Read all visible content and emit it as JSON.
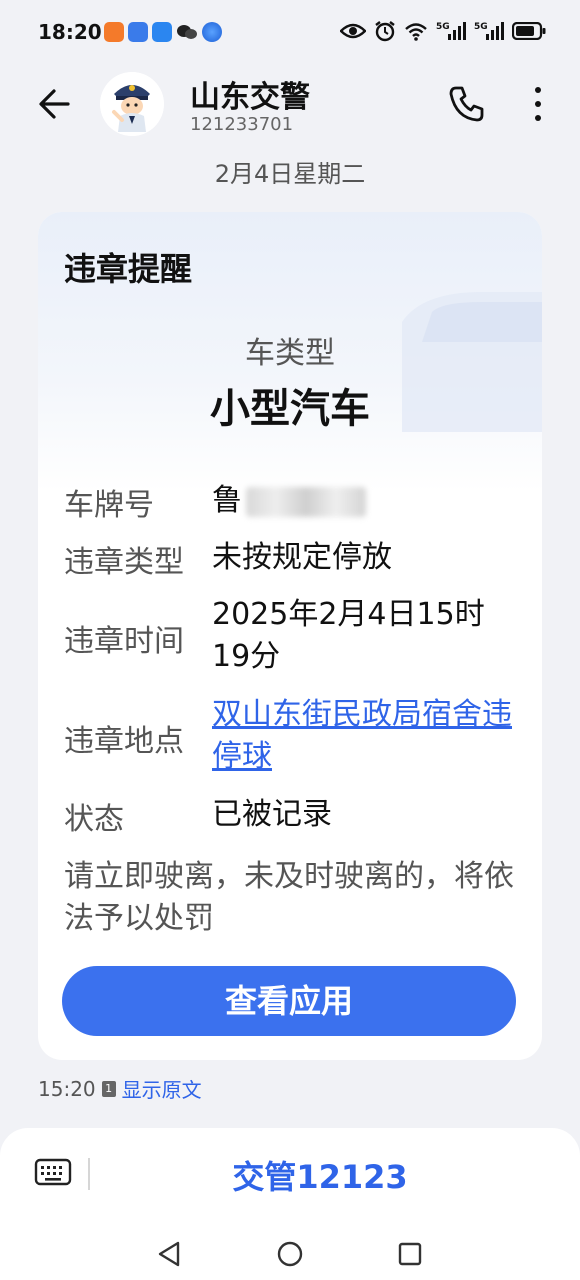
{
  "status_bar": {
    "time": "18:20",
    "notification_icons": [
      "app-icon-orange",
      "app-icon-blue",
      "app-icon-play",
      "wechat-icon",
      "app-icon-round"
    ],
    "right_icons": [
      "eye-icon",
      "alarm-icon",
      "wifi-icon",
      "signal-5g-icon",
      "signal-5g-icon",
      "battery-icon"
    ],
    "signal_label_1": "5G",
    "signal_label_2": "5G"
  },
  "header": {
    "contact_name": "山东交警",
    "contact_number": "121233701"
  },
  "date_label": "2月4日星期二",
  "card": {
    "title": "违章提醒",
    "vehicle_type_label": "车类型",
    "vehicle_type_value": "小型汽车",
    "rows": [
      {
        "label": "车牌号",
        "value": "鲁"
      },
      {
        "label": "违章类型",
        "value": "未按规定停放"
      },
      {
        "label": "违章时间",
        "value": "2025年2月4日15时19分"
      },
      {
        "label": "违章地点",
        "value": "双山东街民政局宿舍违停球"
      },
      {
        "label": "状态",
        "value": "已被记录"
      }
    ],
    "notice": "请立即驶离，未及时驶离的，将依法予以处罚",
    "button_label": "查看应用"
  },
  "message_meta": {
    "time": "15:20",
    "sim": "1",
    "show_original": "显示原文"
  },
  "bottom_bar": {
    "menu_label": "交管12123"
  },
  "colors": {
    "accent": "#3b71ee",
    "link": "#2f64e8",
    "background": "#f1f2f6"
  }
}
